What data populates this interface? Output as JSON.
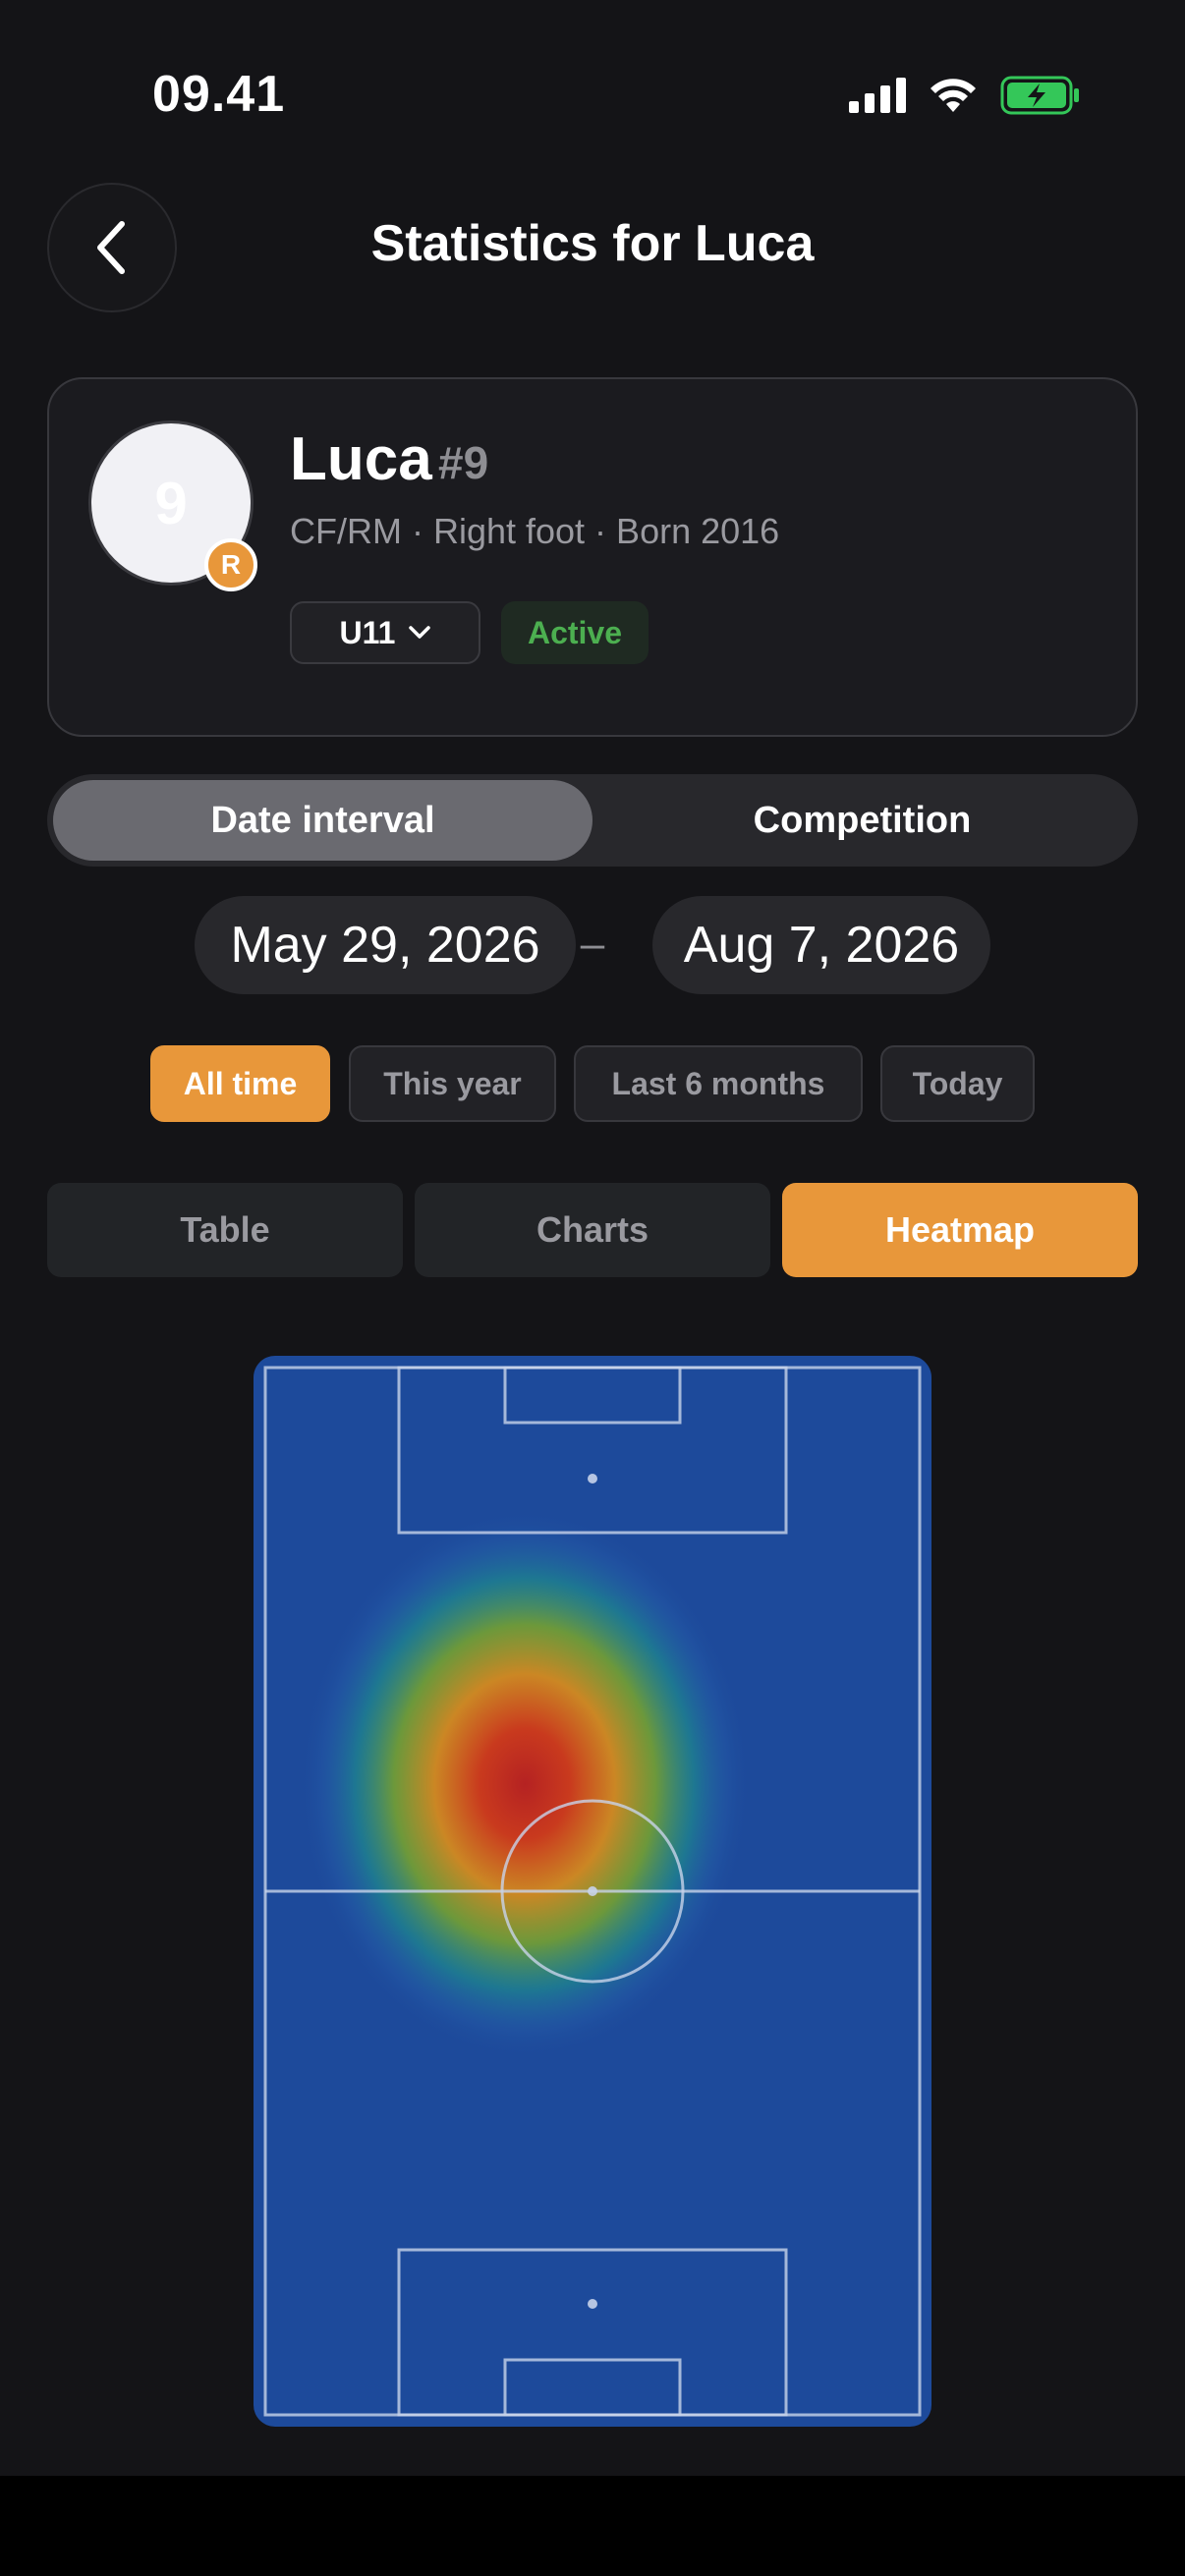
{
  "status_bar": {
    "time": "09.41",
    "battery_color": "#34c759"
  },
  "header": {
    "title": "Statistics for Luca",
    "back_icon": "chevron-left-icon"
  },
  "player": {
    "name": "Luca",
    "number": "#9",
    "avatar_text": "9",
    "role_badge": "R",
    "meta": "CF/RM · Right foot · Born 2016",
    "team": "U11",
    "status": "Active"
  },
  "filter_mode": {
    "options": [
      "Date interval",
      "Competition"
    ],
    "selected": "Date interval"
  },
  "date_range": {
    "start": "May 29, 2026",
    "separator": "–",
    "end": "Aug 7, 2026"
  },
  "quick_filters": {
    "options": [
      "All time",
      "This year",
      "Last 6 months",
      "Today"
    ],
    "selected": "All time"
  },
  "view_tabs": {
    "options": [
      "Table",
      "Charts",
      "Heatmap"
    ],
    "selected": "Heatmap"
  },
  "colors": {
    "accent": "#e8973a",
    "background": "#141417",
    "pitch": "#1d4a9b",
    "active_green": "#4caf50"
  },
  "chart_data": {
    "type": "heatmap",
    "hotspot": {
      "x": 0.4,
      "y": 0.4,
      "intensity": 1.0
    }
  }
}
